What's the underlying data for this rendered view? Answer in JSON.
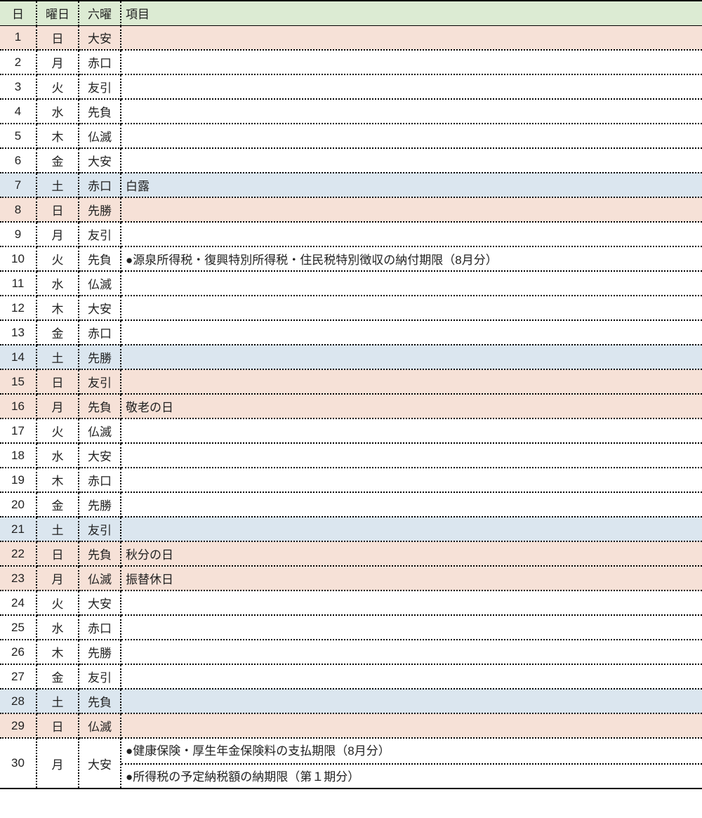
{
  "headers": {
    "day": "日",
    "dow": "曜日",
    "roku": "六曜",
    "item": "項目"
  },
  "rows": [
    {
      "day": "1",
      "dow": "日",
      "roku": "大安",
      "items": [],
      "cls": "sun"
    },
    {
      "day": "2",
      "dow": "月",
      "roku": "赤口",
      "items": [],
      "cls": ""
    },
    {
      "day": "3",
      "dow": "火",
      "roku": "友引",
      "items": [],
      "cls": ""
    },
    {
      "day": "4",
      "dow": "水",
      "roku": "先負",
      "items": [],
      "cls": ""
    },
    {
      "day": "5",
      "dow": "木",
      "roku": "仏滅",
      "items": [],
      "cls": ""
    },
    {
      "day": "6",
      "dow": "金",
      "roku": "大安",
      "items": [],
      "cls": ""
    },
    {
      "day": "7",
      "dow": "土",
      "roku": "赤口",
      "items": [
        "白露"
      ],
      "cls": "sat"
    },
    {
      "day": "8",
      "dow": "日",
      "roku": "先勝",
      "items": [],
      "cls": "sun"
    },
    {
      "day": "9",
      "dow": "月",
      "roku": "友引",
      "items": [],
      "cls": ""
    },
    {
      "day": "10",
      "dow": "火",
      "roku": "先負",
      "items": [
        "●源泉所得税・復興特別所得税・住民税特別徴収の納付期限（8月分）"
      ],
      "cls": ""
    },
    {
      "day": "11",
      "dow": "水",
      "roku": "仏滅",
      "items": [],
      "cls": ""
    },
    {
      "day": "12",
      "dow": "木",
      "roku": "大安",
      "items": [],
      "cls": ""
    },
    {
      "day": "13",
      "dow": "金",
      "roku": "赤口",
      "items": [],
      "cls": ""
    },
    {
      "day": "14",
      "dow": "土",
      "roku": "先勝",
      "items": [],
      "cls": "sat"
    },
    {
      "day": "15",
      "dow": "日",
      "roku": "友引",
      "items": [],
      "cls": "sun"
    },
    {
      "day": "16",
      "dow": "月",
      "roku": "先負",
      "items": [
        "敬老の日"
      ],
      "cls": "holiday"
    },
    {
      "day": "17",
      "dow": "火",
      "roku": "仏滅",
      "items": [],
      "cls": ""
    },
    {
      "day": "18",
      "dow": "水",
      "roku": "大安",
      "items": [],
      "cls": ""
    },
    {
      "day": "19",
      "dow": "木",
      "roku": "赤口",
      "items": [],
      "cls": ""
    },
    {
      "day": "20",
      "dow": "金",
      "roku": "先勝",
      "items": [],
      "cls": ""
    },
    {
      "day": "21",
      "dow": "土",
      "roku": "友引",
      "items": [],
      "cls": "sat"
    },
    {
      "day": "22",
      "dow": "日",
      "roku": "先負",
      "items": [
        "秋分の日"
      ],
      "cls": "sun"
    },
    {
      "day": "23",
      "dow": "月",
      "roku": "仏滅",
      "items": [
        "振替休日"
      ],
      "cls": "holiday"
    },
    {
      "day": "24",
      "dow": "火",
      "roku": "大安",
      "items": [],
      "cls": ""
    },
    {
      "day": "25",
      "dow": "水",
      "roku": "赤口",
      "items": [],
      "cls": ""
    },
    {
      "day": "26",
      "dow": "木",
      "roku": "先勝",
      "items": [],
      "cls": ""
    },
    {
      "day": "27",
      "dow": "金",
      "roku": "友引",
      "items": [],
      "cls": ""
    },
    {
      "day": "28",
      "dow": "土",
      "roku": "先負",
      "items": [],
      "cls": "sat"
    },
    {
      "day": "29",
      "dow": "日",
      "roku": "仏滅",
      "items": [],
      "cls": "sun"
    },
    {
      "day": "30",
      "dow": "月",
      "roku": "大安",
      "items": [
        "●健康保険・厚生年金保険料の支払期限（8月分）",
        "●所得税の予定納税額の納期限（第１期分）"
      ],
      "cls": ""
    }
  ]
}
